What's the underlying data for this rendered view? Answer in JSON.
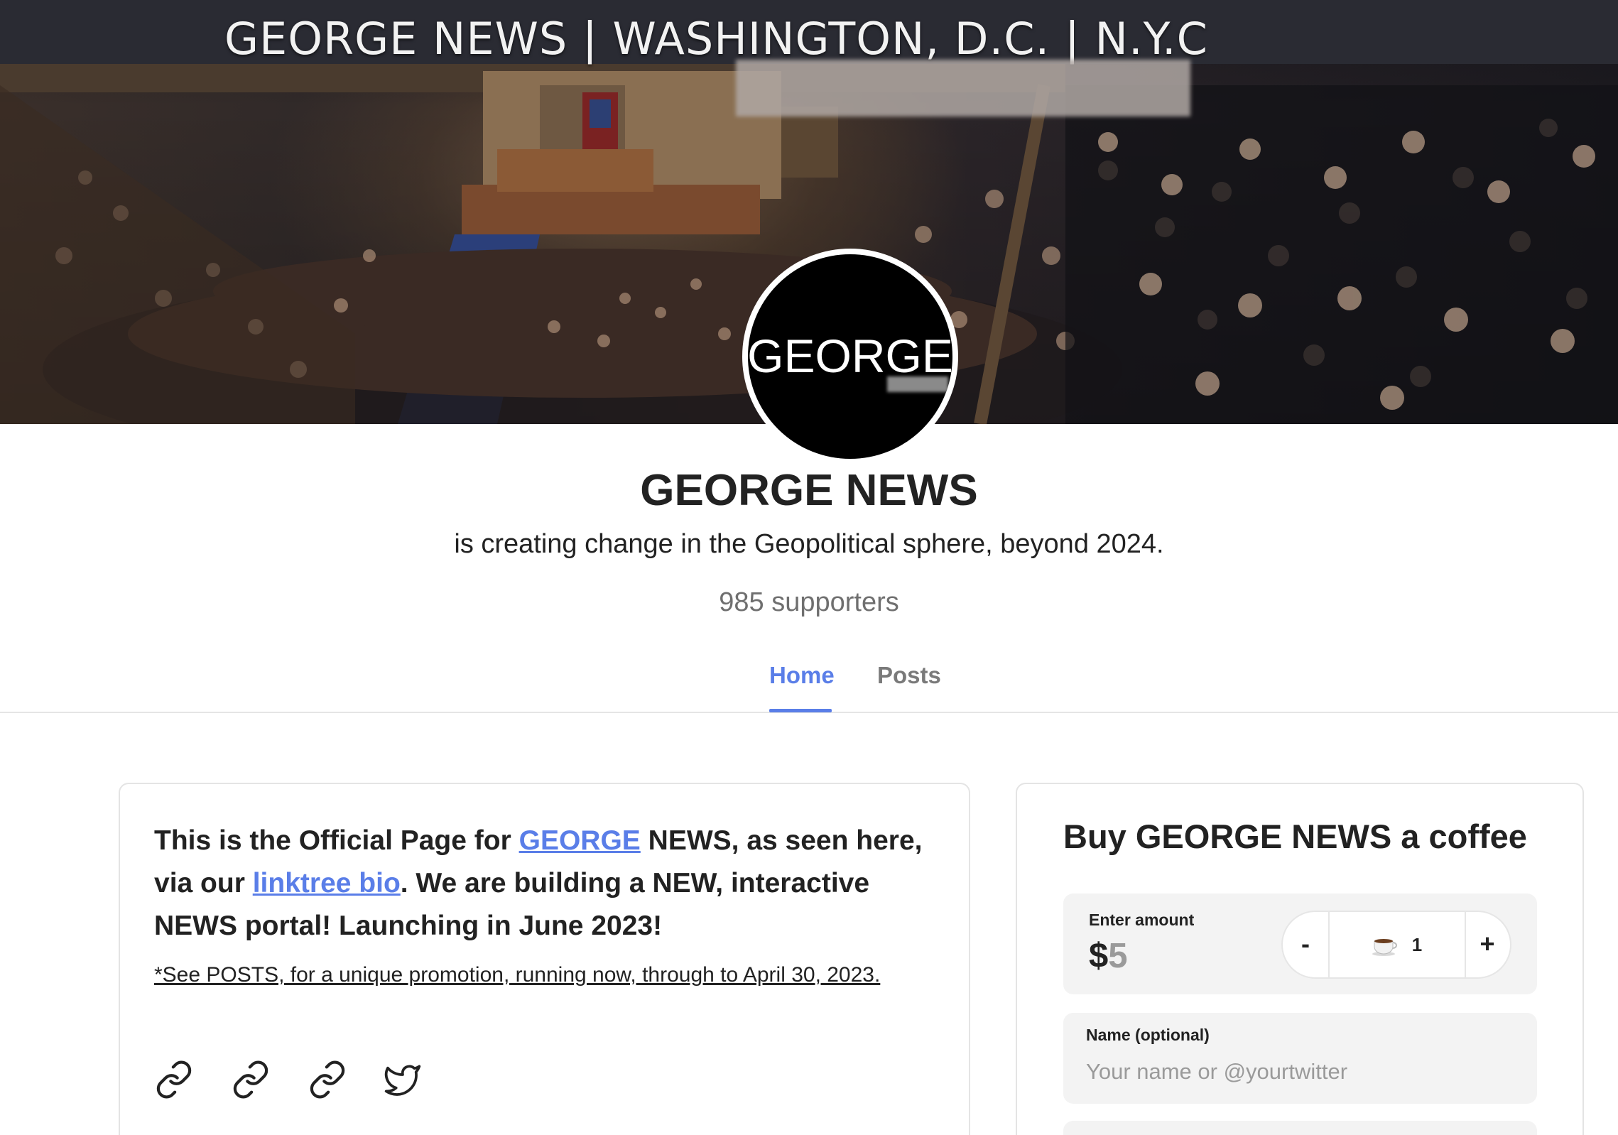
{
  "banner": {
    "title": "GEORGE NEWS | WASHINGTON, D.C. | N.Y.C"
  },
  "avatar": {
    "text": "GEORGE"
  },
  "profile": {
    "name": "GEORGE NEWS",
    "tagline": "is creating change in the Geopolitical sphere, beyond 2024.",
    "supporters": "985 supporters"
  },
  "tabs": [
    {
      "label": "Home",
      "active": true
    },
    {
      "label": "Posts",
      "active": false
    }
  ],
  "about": {
    "text_part1": "This is the Official Page for ",
    "link1": "GEORGE",
    "text_part2": " NEWS, as seen here, via our ",
    "link2": "linktree bio",
    "text_part3": ". We are building a NEW, interactive NEWS portal! Launching in June 2023!",
    "promo_note": "*See POSTS, for a unique promotion, running now, through to April 30, 2023.",
    "social_icons": [
      "link-icon",
      "link-icon",
      "link-icon",
      "twitter-icon"
    ]
  },
  "coffee": {
    "title": "Buy GEORGE NEWS a coffee",
    "amount_label": "Enter amount",
    "currency": "$",
    "amount": "5",
    "stepper_minus": "-",
    "stepper_plus": "+",
    "quantity": "1",
    "cup_icon": "coffee-cup-icon",
    "name_label": "Name (optional)",
    "name_value": "",
    "name_placeholder": "Your name or @yourtwitter"
  },
  "colors": {
    "accent": "#5a7ee8",
    "muted_text": "#6f6f6f",
    "field_bg": "#f3f3f3"
  }
}
